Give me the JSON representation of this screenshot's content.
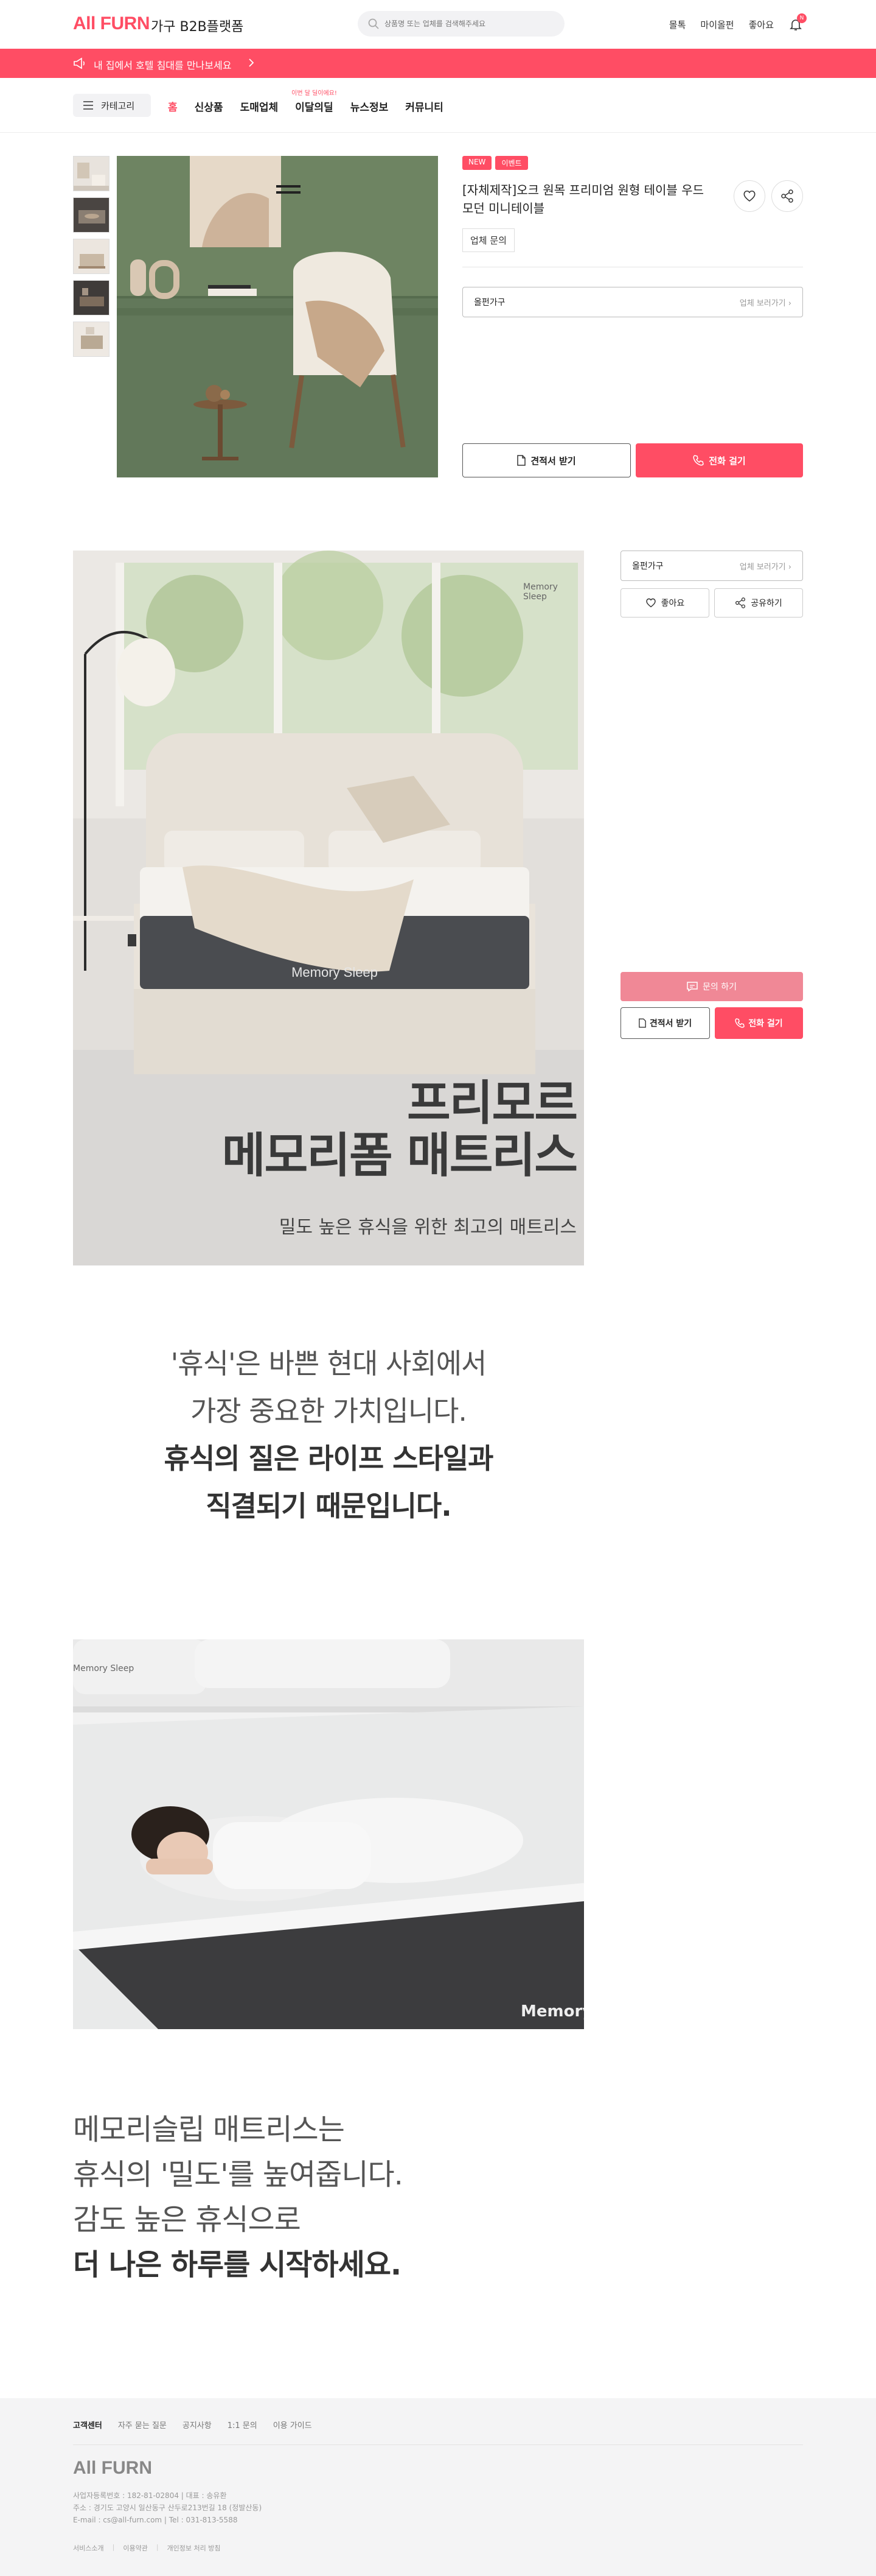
{
  "header": {
    "logo": "All FURN",
    "logo_sub": "가구 B2B플랫폼",
    "search_placeholder": "상품명 또는 업체를 검색해주세요",
    "links": [
      "몰톡",
      "마이올펀",
      "좋아요"
    ],
    "notification_count": "N"
  },
  "notice": {
    "text": "내 집에서 호텔 침대를 만나보세요"
  },
  "nav": {
    "category_label": "카테고리",
    "items": [
      "홈",
      "신상품",
      "도매업체",
      "이달의딜",
      "뉴스정보",
      "커뮤니티"
    ],
    "event_tag": "이번 달 딜이에요!"
  },
  "product": {
    "badges": [
      "NEW",
      "이벤트"
    ],
    "title": "[자체제작]오크 원목 프리미엄 원형 테이블 우드 모던 미니테이블",
    "inquiry_tag": "업체 문의",
    "vendor_name": "올펀가구",
    "vendor_more": "업체 보러가기",
    "btn_estimate": "견적서 받기",
    "btn_call": "전화 걸기"
  },
  "side": {
    "vendor_name": "올펀가구",
    "vendor_more": "업체 보러가기",
    "like": "좋아요",
    "share": "공유하기",
    "inquiry": "문의 하기",
    "estimate": "견적서 받기",
    "call": "전화 걸기"
  },
  "detail": {
    "brand": "Memory Sleep",
    "title_line1": "프리모르",
    "title_line2": "메모리폼 매트리스",
    "subtitle": "밀도 높은 휴식을 위한 최고의 매트리스",
    "quote1_l1": "'휴식'은 바쁜 현대 사회에서",
    "quote1_l2": "가장 중요한 가치입니다.",
    "quote1_l3": "휴식의 질은 라이프 스타일과",
    "quote1_l4": "직결되기 때문입니다.",
    "quote2_l1": "메모리슬립 매트리스는",
    "quote2_l2": "휴식의 '밀도'를 높여줍니다.",
    "quote2_l3": "감도 높은 휴식으로",
    "quote2_l4": "더 나은 하루를 시작하세요.",
    "img2_brand": "Memory"
  },
  "footer": {
    "links": [
      "고객센터",
      "자주 묻는 질문",
      "공지사항",
      "1:1 문의",
      "이용 가이드"
    ],
    "logo": "All FURN",
    "info1": "사업자등록번호 : 182-81-02804 | 대표 : 송유환",
    "info2": "주소 : 경기도 고양시 일산동구 산두로213번길 18 (정발산동)",
    "info3": "E-mail : cs@all-furn.com | Tel : 031-813-5588",
    "bottom": [
      "서비스소개",
      "이용약관",
      "개인정보 처리 방침"
    ]
  }
}
